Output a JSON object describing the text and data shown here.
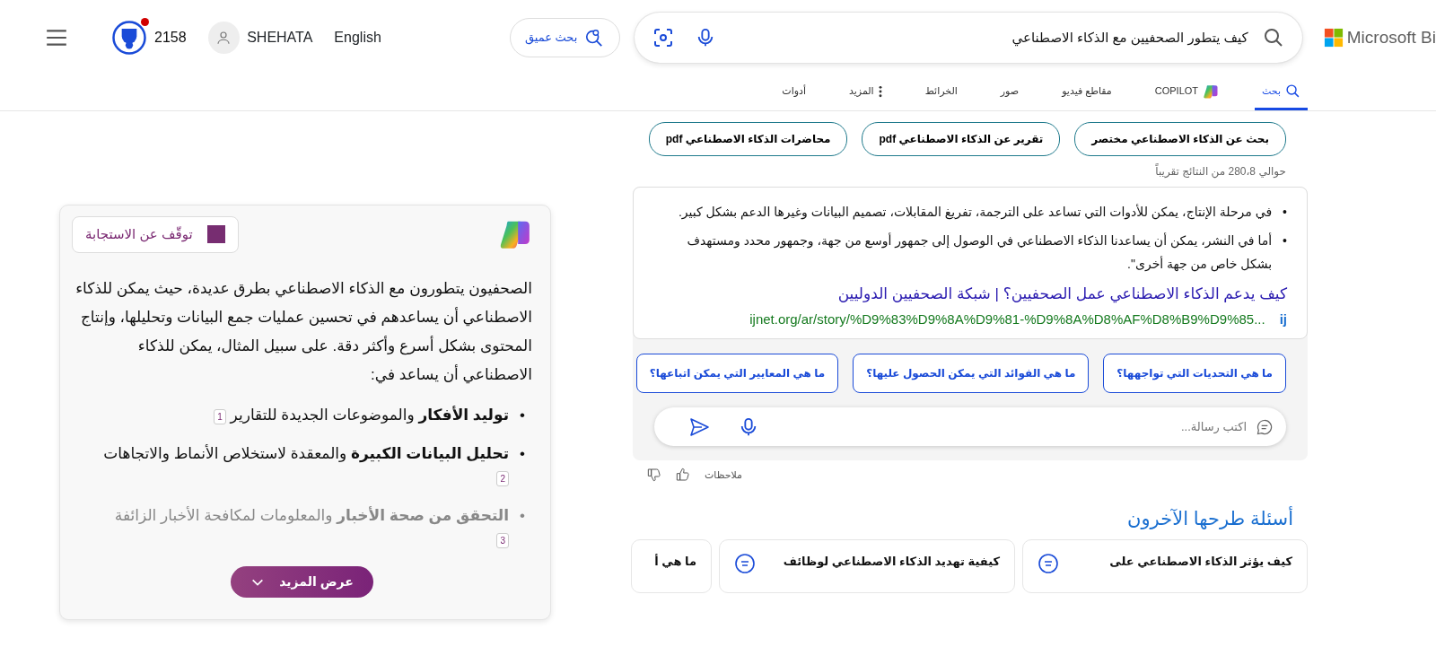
{
  "header": {
    "points": "2158",
    "user": "SHEHATA",
    "language": "English",
    "deep_search": "بحث عميق",
    "query": "كيف يتطور الصحفيين مع الذكاء الاصطناعي",
    "brand": "Microsoft Bi"
  },
  "tabs": [
    {
      "label": "بحث",
      "kind": "search",
      "selected": true
    },
    {
      "label": "COPILOT",
      "kind": "copilot",
      "selected": false
    },
    {
      "label": "مقاطع فيديو",
      "kind": "plain",
      "selected": false
    },
    {
      "label": "صور",
      "kind": "plain",
      "selected": false
    },
    {
      "label": "الخرائط",
      "kind": "plain",
      "selected": false
    },
    {
      "label": "المزيد",
      "kind": "more",
      "selected": false
    },
    {
      "label": "أدوات",
      "kind": "plain",
      "selected": false
    }
  ],
  "related_searches": [
    {
      "text": "بحث عن الذكاء الاصطناعي مختصر"
    },
    {
      "text": "تقرير عن الذكاء الاصطناعي pdf"
    },
    {
      "text": "محاضرات الذكاء الاصطناعي pdf"
    }
  ],
  "results_count": "حوالي 280‪،‬8 من النتائج تقريباً",
  "answer": {
    "bullet_markers": [
      "•",
      "•"
    ],
    "bullets": [
      "في مرحلة الإنتاج، يمكن للأدوات التي تساعد على الترجمة، تفريغ المقابلات، تصميم البيانات وغيرها الدعم بشكل كبير.",
      "أما في النشر، يمكن أن يساعدنا الذكاء الاصطناعي في الوصول إلى جمهور أوسع من جهة، وجمهور محدد ومستهدف بشكل خاص من جهة أخرى\"."
    ],
    "link_title": "كيف يدعم الذكاء الاصطناعي عمل الصحفيين؟ | شبكة الصحفيين الدوليين",
    "site_initials": "ij",
    "url": "ijnet.org/ar/story/%D9%83%D9%8A%D9%81-%D9%8A%D8%AF%D8%B9%D9%85..."
  },
  "suggestions": [
    "ما هي التحديات التي تواجهها؟",
    "ما هي الفوائد التي يمكن الحصول عليها؟",
    "ما هي المعايير التي يمكن اتباعها؟"
  ],
  "chat": {
    "placeholder": "اكتب رسالة..."
  },
  "feedback": "ملاحظات",
  "people_also_ask": {
    "title": "أسئلة طرحها الآخرون",
    "items": [
      "كيف يؤثر الذكاء الاصطناعي على",
      "كيفية تهديد الذكاء الاصطناعي لوظائف",
      "ما هي أ"
    ]
  },
  "copilot": {
    "stop_button": "توقّف عن الاستجابة",
    "intro": "الصحفيون يتطورون مع الذكاء الاصطناعي بطرق عديدة، حيث يمكن للذكاء الاصطناعي أن يساعدهم في تحسين عمليات جمع البيانات وتحليلها، وإنتاج المحتوى بشكل أسرع وأكثر دقة. على سبيل المثال، يمكن للذكاء الاصطناعي أن يساعد في:",
    "points": [
      {
        "text": "**توليد الأفكار** والموضوعات الجديدة للتقارير",
        "citation": "1",
        "faded": false,
        "marker": "•"
      },
      {
        "text": "**تحليل البيانات الكبيرة** والمعقدة لاستخلاص الأنماط والاتجاهات",
        "citation": "2",
        "faded": false,
        "marker": "•"
      },
      {
        "text": "**التحقق من صحة الأخبار** والمعلومات لمكافحة الأخبار الزائفة",
        "citation": "3",
        "faded": true,
        "marker": "•"
      }
    ],
    "more_button": "عرض المزيد"
  }
}
